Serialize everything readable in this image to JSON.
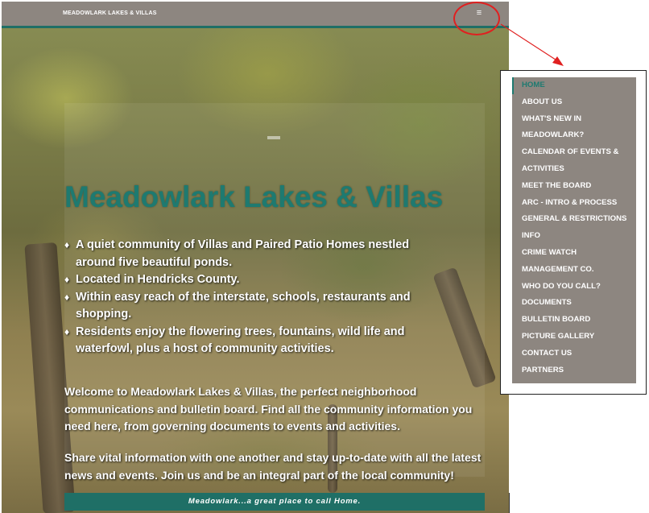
{
  "site": {
    "name": "MEADOWLARK LAKES & VILLAS",
    "menu_icon": "hamburger-icon",
    "menu_glyph": "≡"
  },
  "hero": {
    "title": "Meadowlark Lakes & Villas",
    "bullets": [
      "A quiet community of Villas and Paired Patio Homes nestled around five beautiful ponds.",
      "Located in Hendricks County.",
      "Within easy reach of the interstate, schools, restaurants and shopping.",
      "Residents enjoy the flowering trees, fountains, wild life and waterfowl, plus a host of community activities."
    ],
    "welcome": "Welcome to Meadowlark Lakes & Villas, the perfect neighborhood communications and bulletin board.  Find all the community information you need here, from governing documents to events and activities.",
    "share": "Share vital information with one another and stay up-to-date with all the latest news and events.  Join us and be an integral part of the local community!",
    "tagline": "Meadowlark...a great place to call Home."
  },
  "nav_menu": {
    "items": [
      "HOME",
      "ABOUT US",
      "WHAT'S NEW IN",
      "MEADOWLARK?",
      "CALENDAR OF EVENTS &",
      "ACTIVITIES",
      "MEET THE BOARD",
      "ARC - INTRO & PROCESS",
      "GENERAL & RESTRICTIONS",
      "INFO",
      "CRIME WATCH",
      "MANAGEMENT CO.",
      "WHO DO YOU CALL?",
      "DOCUMENTS",
      "BULLETIN BOARD",
      "PICTURE GALLERY",
      "CONTACT US",
      "PARTNERS"
    ],
    "active": "HOME"
  },
  "colors": {
    "accent_teal": "#1e7a70",
    "header_gray": "#8d8680",
    "annotation_red": "#e02020"
  }
}
